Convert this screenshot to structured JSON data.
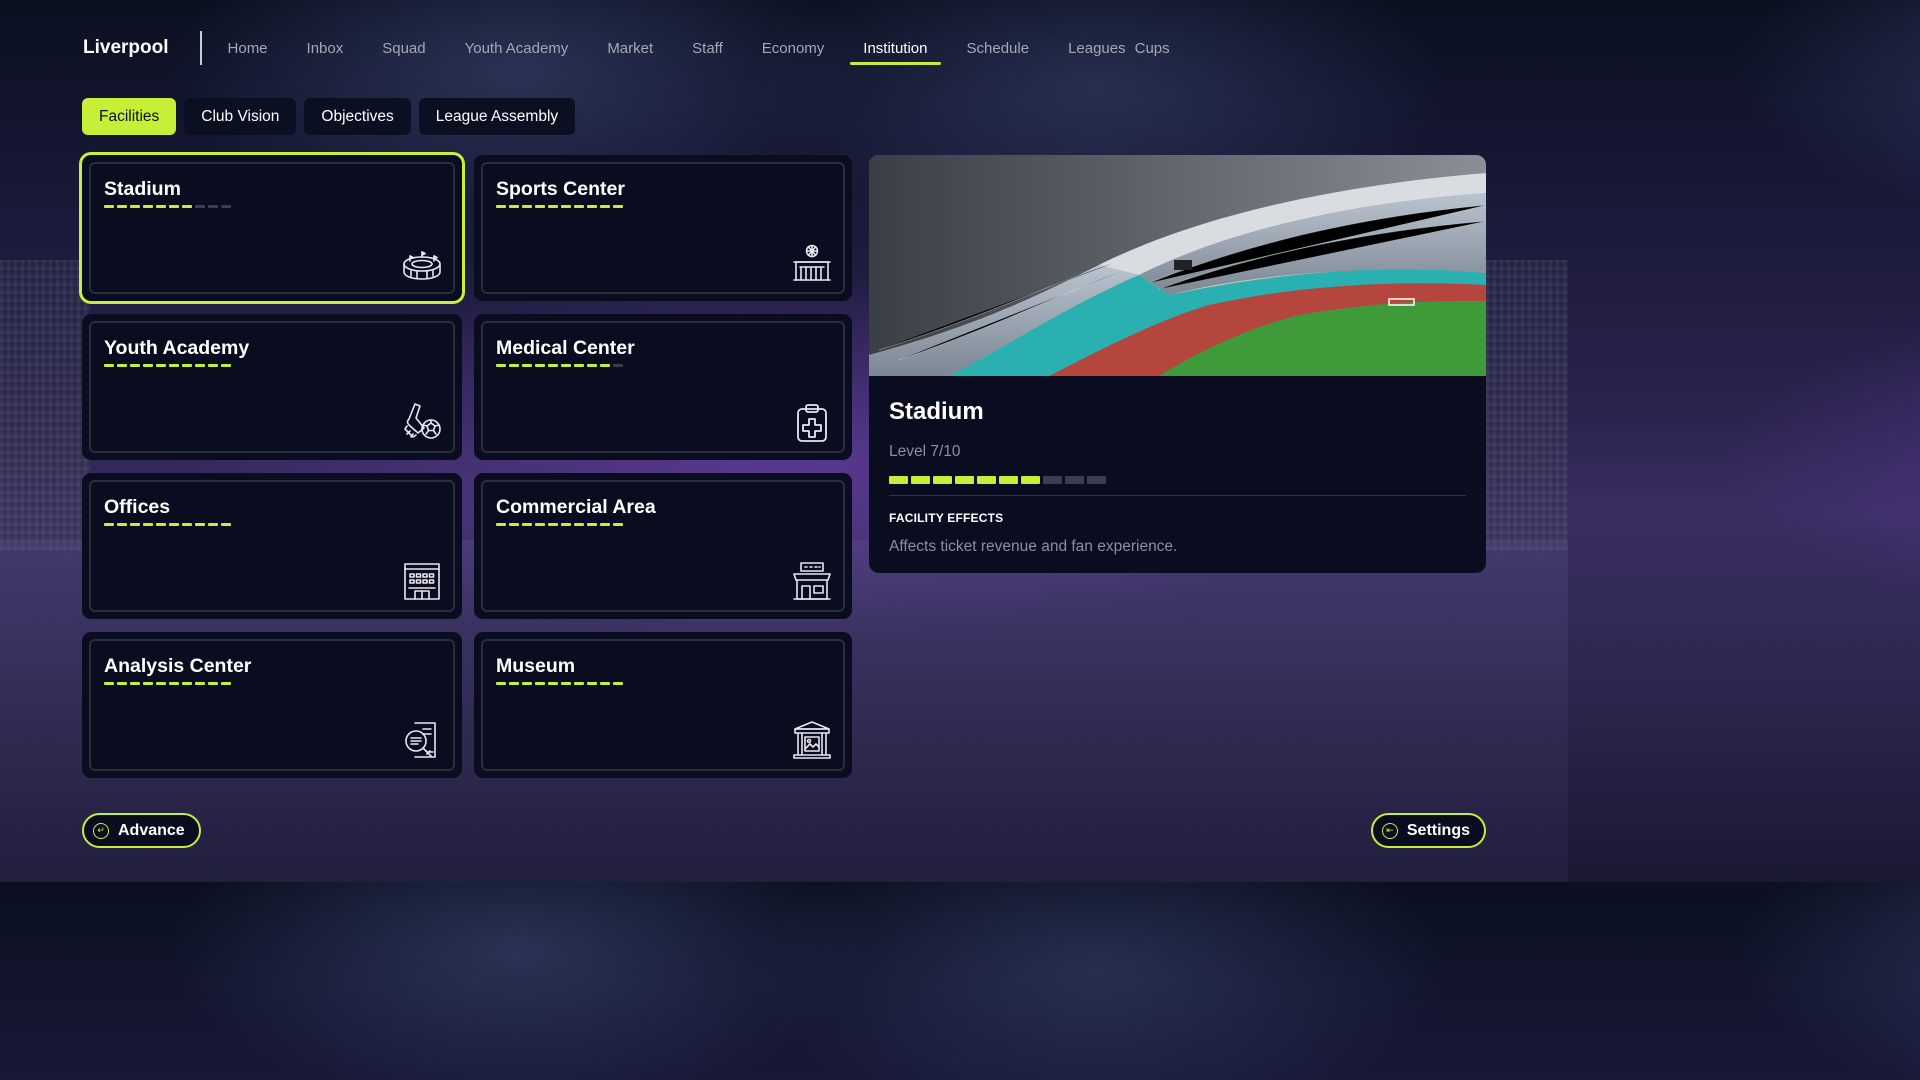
{
  "app": {
    "club_name": "Liverpool"
  },
  "nav": {
    "items": [
      {
        "label": "Home",
        "active": false
      },
      {
        "label": "Inbox",
        "active": false
      },
      {
        "label": "Squad",
        "active": false
      },
      {
        "label": "Youth Academy",
        "active": false
      },
      {
        "label": "Market",
        "active": false
      },
      {
        "label": "Staff",
        "active": false
      },
      {
        "label": "Economy",
        "active": false
      },
      {
        "label": "Institution",
        "active": true
      },
      {
        "label": "Schedule",
        "active": false
      },
      {
        "label": "Leagues",
        "active": false
      },
      {
        "label": "Cups",
        "active": false
      }
    ]
  },
  "subtabs": [
    {
      "label": "Facilities",
      "active": true
    },
    {
      "label": "Club Vision",
      "active": false
    },
    {
      "label": "Objectives",
      "active": false
    },
    {
      "label": "League Assembly",
      "active": false
    }
  ],
  "facilities": [
    {
      "name": "Stadium",
      "level": 7,
      "max_level": 10,
      "icon": "stadium-icon",
      "selected": true
    },
    {
      "name": "Sports Center",
      "level": 10,
      "max_level": 10,
      "icon": "sports-center-icon",
      "selected": false
    },
    {
      "name": "Youth Academy",
      "level": 10,
      "max_level": 10,
      "icon": "youth-academy-icon",
      "selected": false
    },
    {
      "name": "Medical Center",
      "level": 9,
      "max_level": 10,
      "icon": "medical-center-icon",
      "selected": false
    },
    {
      "name": "Offices",
      "level": 10,
      "max_level": 10,
      "icon": "offices-icon",
      "selected": false
    },
    {
      "name": "Commercial Area",
      "level": 10,
      "max_level": 10,
      "icon": "commercial-area-icon",
      "selected": false
    },
    {
      "name": "Analysis Center",
      "level": 10,
      "max_level": 10,
      "icon": "analysis-center-icon",
      "selected": false
    },
    {
      "name": "Museum",
      "level": 10,
      "max_level": 10,
      "icon": "museum-icon",
      "selected": false
    }
  ],
  "detail": {
    "title": "Stadium",
    "level_text": "Level 7/10",
    "level": 7,
    "max_level": 10,
    "effects_heading": "FACILITY EFFECTS",
    "effects_text": "Affects ticket revenue and fan experience.",
    "image": "stadium-photo"
  },
  "buttons": {
    "advance": "Advance",
    "settings": "Settings"
  },
  "colors": {
    "accent": "#c6f038",
    "card_bg": "#0a0d1f",
    "muted_text": "#8b8f9e"
  }
}
